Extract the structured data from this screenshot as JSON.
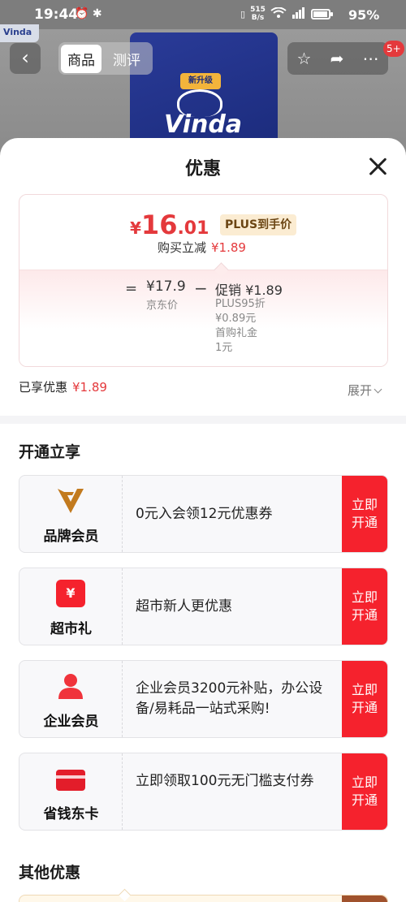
{
  "status_bar": {
    "time": "19:44",
    "left_icons": "⏰ ✱",
    "speed_top": "515",
    "speed_bottom": "B/s",
    "battery_percent": "95%",
    "battery_level": 0.95
  },
  "product_header": {
    "brand_corner": "Vinda",
    "pack_tag": "新升级",
    "pack_brand": "Vinda",
    "tabs": [
      "商品",
      "测评"
    ],
    "active_tab": "商品",
    "message_badge": "5+"
  },
  "sheet": {
    "title": "优惠"
  },
  "price_card": {
    "currency": "¥",
    "final_int": "16",
    "final_dec": ".01",
    "plus_tag": "PLUS到手价",
    "reduce_label": "购买立减",
    "reduce_amount": "¥1.89",
    "eq": "=",
    "jd_price": "¥17.9",
    "jd_label": "京东价",
    "minus": "−",
    "promo_title": "促销 ¥1.89",
    "promo_lines": [
      "PLUS95折",
      "¥0.89元",
      "首购礼金",
      "1元"
    ]
  },
  "enjoyed": {
    "label": "已享优惠",
    "amount": "¥1.89",
    "expand_label": "展开"
  },
  "open_section": {
    "title": "开通立享",
    "items": [
      {
        "name": "品牌会员",
        "desc": "0元入会领12元优惠券",
        "button": "立即开通",
        "icon": "brand-v-icon"
      },
      {
        "name": "超市礼",
        "desc": "超市新人更优惠",
        "button": "立即开通",
        "icon": "ticket-yen-icon"
      },
      {
        "name": "企业会员",
        "desc": "企业会员3200元补贴，办公设备/易耗品一站式采购!",
        "button": "立即开通",
        "icon": "person-icon"
      },
      {
        "name": "省钱东卡",
        "desc": "立即领取100元无门槛支付券",
        "button": "立即开通",
        "icon": "card-icon"
      }
    ]
  },
  "other_section": {
    "title": "其他优惠"
  },
  "colors": {
    "accent_red": "#e4393c",
    "button_red": "#f5222d",
    "plus_gold": "#fbecd2"
  }
}
